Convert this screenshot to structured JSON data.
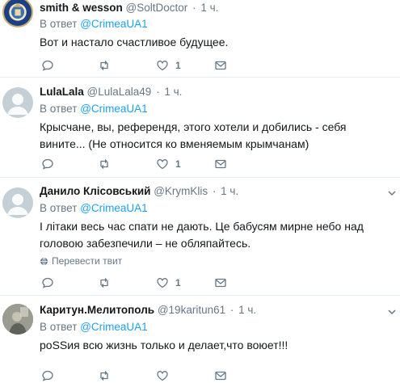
{
  "tweets": [
    {
      "name": "smith & wesson",
      "handle": "@SoltDoctor",
      "time": "1 ч.",
      "reply_prefix": "В ответ",
      "reply_to": "@CrimeaUA1",
      "text": "Вот и настало счастливое будущее.",
      "like_count": "1"
    },
    {
      "name": "LulaLala",
      "handle": "@LulaLala49",
      "time": "1 ч.",
      "reply_prefix": "В ответ",
      "reply_to": "@CrimeaUA1",
      "text": "Крысчане, вы, референдя, этого хотели и добились - себя вините... (Не относится ко вменяемым крымчанам)",
      "like_count": "1"
    },
    {
      "name": "Данило Клісовський",
      "handle": "@KrymKlis",
      "time": "1 ч.",
      "reply_prefix": "В ответ",
      "reply_to": "@CrimeaUA1",
      "text": "І літаки весь час спати не дають. Це бабусям мирне небо над головою забезпечили – не обляпайтесь.",
      "translate_label": "Перевести твит",
      "like_count": "1"
    },
    {
      "name": "Каритун.Мелитополь",
      "handle": "@19karitun61",
      "time": "1 ч.",
      "reply_prefix": "В ответ",
      "reply_to": "@CrimeaUA1",
      "text": "роSSия всю жизнь только и делает,что воюет!!!"
    }
  ],
  "separator": "·",
  "colors": {
    "link": "#1da1f2",
    "muted": "#657786",
    "border": "#e6ecf0",
    "text": "#14171a"
  },
  "icons": [
    "reply-icon",
    "retweet-icon",
    "like-icon",
    "message-icon",
    "chevron-down-icon",
    "globe-icon"
  ]
}
